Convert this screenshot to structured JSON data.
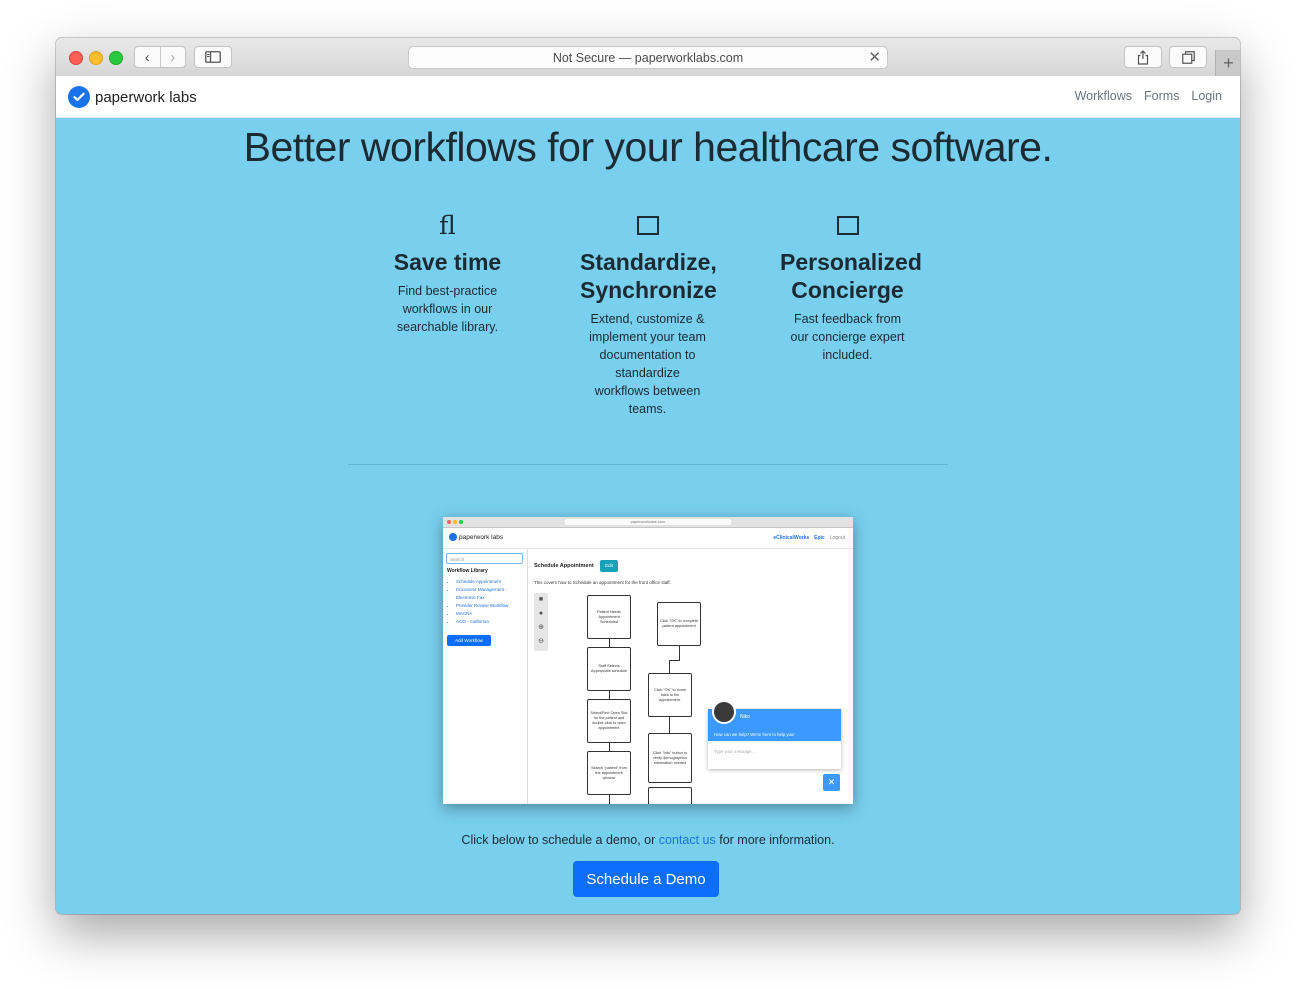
{
  "browser": {
    "url_text": "Not Secure — paperworklabs.com",
    "back_icon": "chevron-left-icon",
    "forward_icon": "chevron-right-icon",
    "newtab_glyph": "+"
  },
  "nav": {
    "brand": "paperwork labs",
    "links": [
      "Workflows",
      "Forms",
      "Login"
    ]
  },
  "hero": {
    "headline": "Better workflows for your healthcare software."
  },
  "features": [
    {
      "icon": "fl",
      "title_lines": [
        "Save time"
      ],
      "text_lines": [
        "Find best-practice",
        "workflows in our",
        "searchable library."
      ]
    },
    {
      "icon": "square-icon",
      "title_lines": [
        "Standardize,",
        "Synchronize"
      ],
      "text_lines": [
        "Extend, customize &",
        "implement your team",
        "documentation to",
        "standardize",
        "workflows between",
        "teams."
      ]
    },
    {
      "icon": "square-icon",
      "title_lines": [
        "Personalized",
        "Concierge"
      ],
      "text_lines": [
        "Fast feedback from",
        "our concierge expert",
        "included."
      ]
    }
  ],
  "screenshot": {
    "url": "paperworklabs.com",
    "brand": "paperwork labs",
    "links": [
      "eClinicalWorks",
      "Epic",
      "Logout"
    ],
    "search_placeholder": "Search",
    "library_heading": "Workflow Library",
    "library_items": [
      "Schedule Appointment",
      "Document Management -",
      "Electronic Fax",
      "Provider Review Workflow",
      "MACRA",
      "ACO - California"
    ],
    "add_button": "Add Workflow",
    "title": "Schedule Appointment",
    "edit_button": "Edit",
    "description": "This covers how to Schedule an appointment for the front office staff.",
    "flow_left": [
      "Patient Needs Appointment Scheduled",
      "Staff Selects Appropriate schedule",
      "Select/Find Open Slot for the patient and double click to open appointment",
      "Search \"patient\" from the appointment window"
    ],
    "flow_right": [
      "Click \"OK\" to complete patient appointment",
      "Click \"OK\" to come back to the appointment.",
      "Click \"Info\" button to verify demographics information needed"
    ],
    "chat_name": "Niko",
    "chat_message": "How can we help? We're here to help you!",
    "chat_placeholder": "Type your message..."
  },
  "cta": {
    "text_before": "Click below to schedule a demo, or",
    "link": "contact us",
    "text_after": "for more information.",
    "button": "Schedule a Demo"
  },
  "colors": {
    "hero_bg": "#78cfee",
    "primary": "#0d6efd",
    "brand_blue": "#1a73e8"
  }
}
